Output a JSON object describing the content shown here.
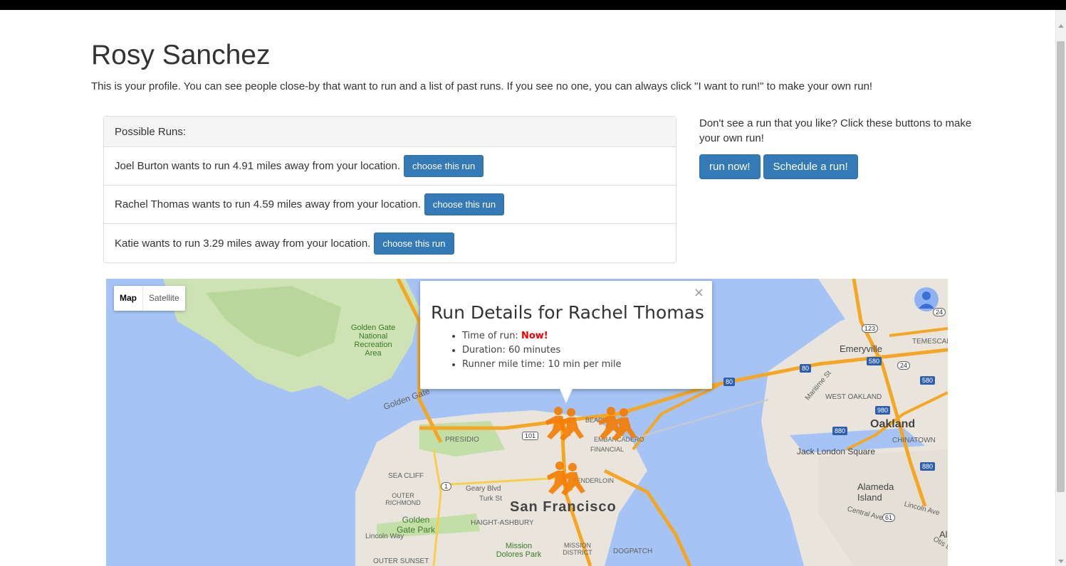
{
  "profile": {
    "name": "Rosy Sanchez",
    "intro": "This is your profile. You can see people close-by that want to run and a list of past runs. If you see no one, you can always click \"I want to run!\" to make your own run!"
  },
  "runs_panel": {
    "heading": "Possible Runs:",
    "items": [
      {
        "text": "Joel Burton wants to run 4.91 miles away from your location.",
        "button": "choose this run"
      },
      {
        "text": "Rachel Thomas wants to run 4.59 miles away from your location.",
        "button": "choose this run"
      },
      {
        "text": "Katie wants to run 3.29 miles away from your location.",
        "button": "choose this run"
      }
    ]
  },
  "side": {
    "text": "Don't see a run that you like? Click these buttons to make your own run!",
    "run_now": "run now!",
    "schedule": "Schedule a run!"
  },
  "map": {
    "type_map": "Map",
    "type_satellite": "Satellite",
    "labels": {
      "golden_gate_area": "Golden Gate National Recreation Area",
      "golden_gate": "Golden Gate",
      "emeryville": "Emeryville",
      "temescal": "TEMESCAL",
      "oakland": "Oakland",
      "west_oakland": "WEST OAKLAND",
      "chinatown": "CHINATOWN",
      "jack_london": "Jack London Square",
      "alameda": "Alameda Island",
      "san_francisco": "San Francisco",
      "presidio": "PRESIDIO",
      "sea_cliff": "SEA CLIFF",
      "outer_richmond": "OUTER RICHMOND",
      "golden_gate_park": "Golden Gate Park",
      "haight": "HAIGHT-ASHBURY",
      "mission_dolores": "Mission Dolores Park",
      "mission_district": "MISSION DISTRICT",
      "dogpatch": "DOGPATCH",
      "outer_sunset": "OUTER SUNSET",
      "geary": "Geary Blvd",
      "turk": "Turk St",
      "lincoln_way": "Lincoln Way",
      "maritime": "Maritime St",
      "central": "Central Ave",
      "lincoln_ave": "Lincoln Ave",
      "embarcadero": "EMBARCADERO",
      "financial": "FINANCIAL",
      "tenderloin": "TENDERLOIN",
      "beach": "BEACH",
      "otis": "Otis Dr",
      "al": "Al"
    },
    "shields": {
      "i80_a": "80",
      "i80_b": "80",
      "i580_a": "580",
      "i580_b": "580",
      "i880_a": "880",
      "i880_b": "880",
      "i980": "980",
      "us101": "101",
      "r1": "1",
      "r24_a": "24",
      "r24_b": "24",
      "r123": "123",
      "r61": "61"
    }
  },
  "infowindow": {
    "title": "Run Details for Rachel Thomas",
    "time_label": "Time of run: ",
    "time_value": "Now!",
    "duration": "Duration: 60 minutes",
    "mile_time": "Runner mile time: 10 min per mile",
    "close": "×"
  }
}
